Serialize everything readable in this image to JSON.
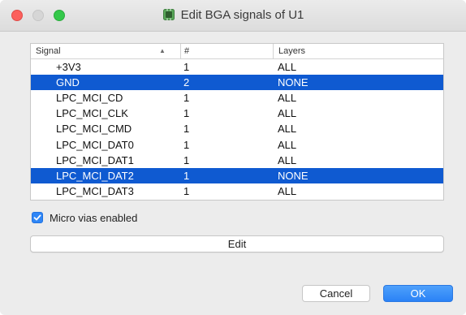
{
  "window": {
    "title": "Edit BGA signals of U1"
  },
  "table": {
    "columns": {
      "signal": "Signal",
      "sort_indicator": "▲",
      "count": "#",
      "layers": "Layers"
    },
    "rows": [
      {
        "signal": "+3V3",
        "count": "1",
        "layers": "ALL",
        "selected": false
      },
      {
        "signal": "GND",
        "count": "2",
        "layers": "NONE",
        "selected": true
      },
      {
        "signal": "LPC_MCI_CD",
        "count": "1",
        "layers": "ALL",
        "selected": false
      },
      {
        "signal": "LPC_MCI_CLK",
        "count": "1",
        "layers": "ALL",
        "selected": false
      },
      {
        "signal": "LPC_MCI_CMD",
        "count": "1",
        "layers": "ALL",
        "selected": false
      },
      {
        "signal": "LPC_MCI_DAT0",
        "count": "1",
        "layers": "ALL",
        "selected": false
      },
      {
        "signal": "LPC_MCI_DAT1",
        "count": "1",
        "layers": "ALL",
        "selected": false
      },
      {
        "signal": "LPC_MCI_DAT2",
        "count": "1",
        "layers": "NONE",
        "selected": true
      },
      {
        "signal": "LPC_MCI_DAT3",
        "count": "1",
        "layers": "ALL",
        "selected": false
      }
    ]
  },
  "options": {
    "micro_vias_label": "Micro vias enabled",
    "micro_vias_checked": true
  },
  "buttons": {
    "edit": "Edit",
    "cancel": "Cancel",
    "ok": "OK"
  },
  "colors": {
    "selection": "#0f5ad1",
    "accent": "#2f86f6"
  }
}
